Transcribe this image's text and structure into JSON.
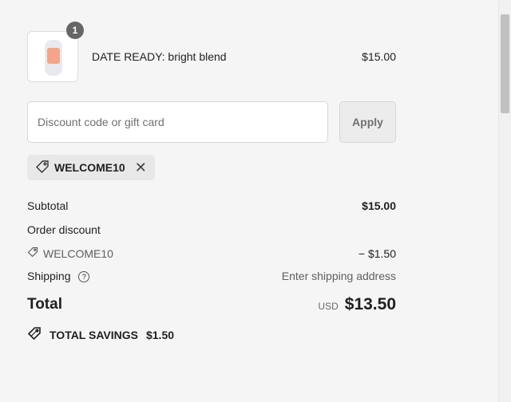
{
  "product": {
    "quantity": "1",
    "name": "DATE READY: bright blend",
    "price": "$15.00",
    "image_icon": "product-bottle"
  },
  "discount": {
    "placeholder": "Discount code or gift card",
    "apply_label": "Apply",
    "applied_code": "WELCOME10"
  },
  "summary": {
    "subtotal_label": "Subtotal",
    "subtotal_value": "$15.00",
    "order_discount_label": "Order discount",
    "discount_code": "WELCOME10",
    "discount_value": "− $1.50",
    "shipping_label": "Shipping",
    "shipping_value": "Enter shipping address",
    "total_label": "Total",
    "currency": "USD",
    "total_value": "$13.50",
    "savings_label": "TOTAL SAVINGS",
    "savings_value": "$1.50"
  },
  "colors": {
    "background": "#f5f5f5",
    "text": "#1f1f1f",
    "muted": "#5e5e5e",
    "badge": "#666666",
    "tag_background": "#e8e8e8"
  }
}
